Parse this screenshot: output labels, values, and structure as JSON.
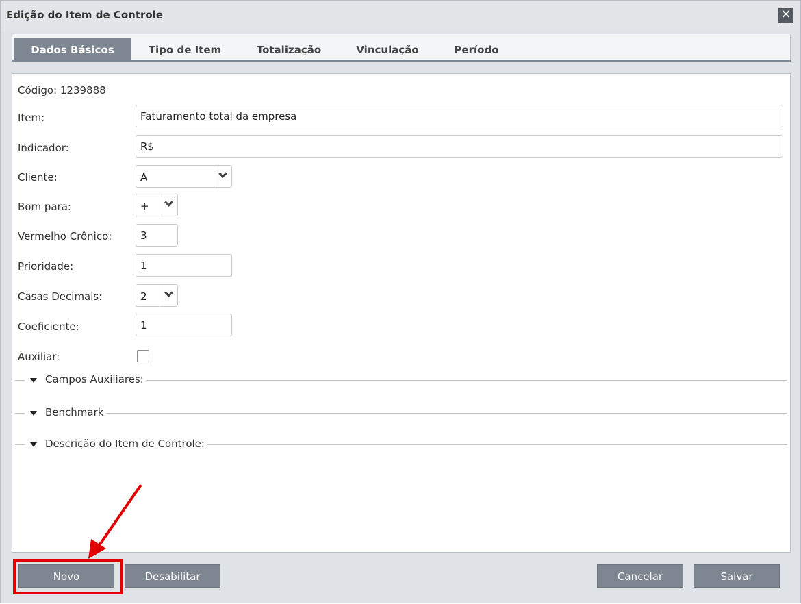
{
  "dialog": {
    "title": "Edição do Item de Controle",
    "close_icon": "close-icon"
  },
  "tabs": [
    {
      "label": "Dados Básicos",
      "active": true
    },
    {
      "label": "Tipo de Item",
      "active": false
    },
    {
      "label": "Totalização",
      "active": false
    },
    {
      "label": "Vinculação",
      "active": false
    },
    {
      "label": "Período",
      "active": false
    }
  ],
  "form": {
    "codigo": "Código: 1239888",
    "item": {
      "label": "Item:",
      "value": "Faturamento total da empresa"
    },
    "indicador": {
      "label": "Indicador:",
      "value": "R$"
    },
    "cliente": {
      "label": "Cliente:",
      "value": "A"
    },
    "bom_para": {
      "label": "Bom para:",
      "value": "+"
    },
    "vermelho_cronico": {
      "label": "Vermelho Crônico:",
      "value": "3"
    },
    "prioridade": {
      "label": "Prioridade:",
      "value": "1"
    },
    "casas_decimais": {
      "label": "Casas Decimais:",
      "value": "2"
    },
    "coeficiente": {
      "label": "Coeficiente:",
      "value": "1"
    },
    "auxiliar": {
      "label": "Auxiliar:",
      "checked": false
    }
  },
  "sections": [
    {
      "label": "Campos Auxiliares:"
    },
    {
      "label": "Benchmark"
    },
    {
      "label": "Descrição do Item de Controle:"
    }
  ],
  "buttons": {
    "novo": "Novo",
    "desabilitar": "Desabilitar",
    "cancelar": "Cancelar",
    "salvar": "Salvar"
  },
  "colors": {
    "accent": "#7e8791",
    "annotation": "#e00000"
  }
}
